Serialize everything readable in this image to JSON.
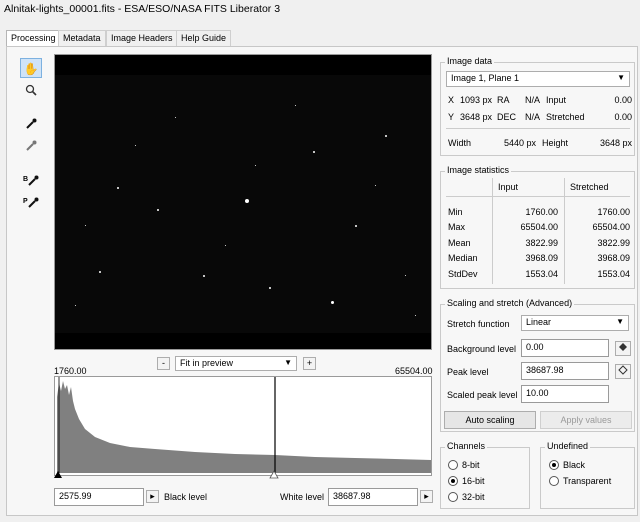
{
  "window": {
    "title": "Alnitak-lights_00001.fits - ESA/ESO/NASA FITS Liberator 3"
  },
  "tabs": [
    {
      "label": "Processing",
      "active": true
    },
    {
      "label": "Metadata"
    },
    {
      "label": "Image Headers"
    },
    {
      "label": "Help Guide"
    }
  ],
  "toolbar": {
    "tools": [
      {
        "name": "hand-icon",
        "glyph": "✋",
        "selected": true
      },
      {
        "name": "zoom-icon",
        "glyph": "🔍"
      },
      {
        "name": "eyedropper-black-icon",
        "glyph": "✒"
      },
      {
        "name": "eyedropper-white-icon",
        "glyph": "✒"
      },
      {
        "name": "eyedropper-background-icon",
        "glyph": "✒",
        "prefix": "B"
      },
      {
        "name": "eyedropper-peak-icon",
        "glyph": "✒",
        "prefix": "P"
      }
    ]
  },
  "preview": {
    "zoom_minus": "-",
    "zoom_plus": "+",
    "zoom_value": "Fit in preview",
    "range_min": "1760.00",
    "range_max": "65504.00"
  },
  "levels": {
    "black_value": "2575.99",
    "black_label": "Black level",
    "white_label": "White level",
    "white_value": "38687.98"
  },
  "image_data": {
    "title": "Image data",
    "selector": "Image 1, Plane 1",
    "x_label": "X",
    "x_value": "1093 px",
    "y_label": "Y",
    "y_value": "3648 px",
    "ra_label": "RA",
    "ra_value": "N/A",
    "dec_label": "DEC",
    "dec_value": "N/A",
    "input_label": "Input",
    "input_value": "0.00",
    "stretched_label": "Stretched",
    "stretched_value": "0.00",
    "width_label": "Width",
    "width_value": "5440 px",
    "height_label": "Height",
    "height_value": "3648 px"
  },
  "stats": {
    "title": "Image statistics",
    "col_input": "Input",
    "col_stretched": "Stretched",
    "rows": [
      {
        "label": "Min",
        "input": "1760.00",
        "stretched": "1760.00"
      },
      {
        "label": "Max",
        "input": "65504.00",
        "stretched": "65504.00"
      },
      {
        "label": "Mean",
        "input": "3822.99",
        "stretched": "3822.99"
      },
      {
        "label": "Median",
        "input": "3968.09",
        "stretched": "3968.09"
      },
      {
        "label": "StdDev",
        "input": "1553.04",
        "stretched": "1553.04"
      }
    ]
  },
  "scaling": {
    "title": "Scaling and stretch (Advanced)",
    "stretch_label": "Stretch function",
    "stretch_value": "Linear",
    "background_label": "Background level",
    "background_value": "0.00",
    "peak_label": "Peak level",
    "peak_value": "38687.98",
    "scaled_peak_label": "Scaled peak level",
    "scaled_peak_value": "10.00",
    "auto_button": "Auto scaling",
    "apply_button": "Apply values"
  },
  "channels": {
    "title": "Channels",
    "options": [
      {
        "label": "8-bit",
        "checked": false
      },
      {
        "label": "16-bit",
        "checked": true
      },
      {
        "label": "32-bit",
        "checked": false
      }
    ]
  },
  "undefined": {
    "title": "Undefined",
    "options": [
      {
        "label": "Black",
        "checked": true
      },
      {
        "label": "Transparent",
        "checked": false
      }
    ]
  },
  "colors": {
    "selection": "#cfe3f7",
    "histogram": "#808080",
    "preview_bg": "#000000"
  }
}
